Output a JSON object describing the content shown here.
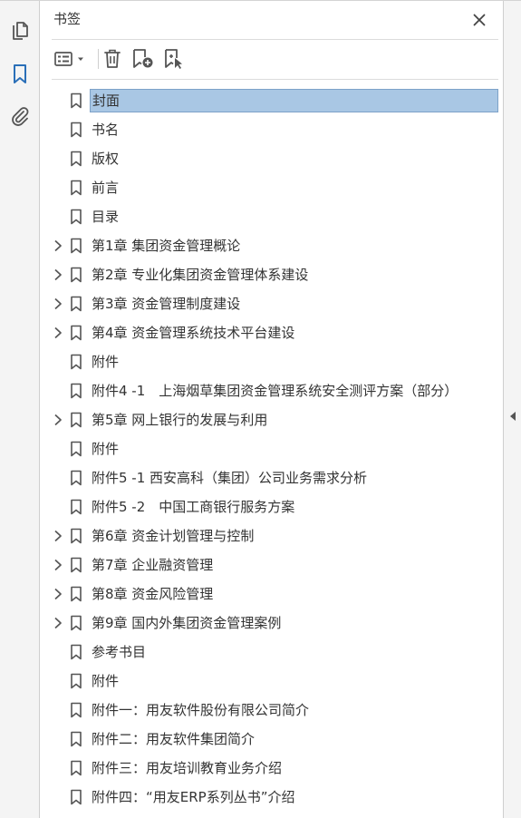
{
  "panel": {
    "title": "书签"
  },
  "rail": {
    "icons": [
      "page-thumbnails-icon",
      "bookmark-icon",
      "attachment-icon"
    ],
    "active_index": 1
  },
  "toolbar": {
    "icons": [
      "options-menu-icon",
      "delete-icon",
      "new-bookmark-icon",
      "bookmark-from-selection-icon"
    ]
  },
  "colors": {
    "accent": "#2a6fb8",
    "icon": "#555555",
    "selection_fill": "#a9c7e4",
    "selection_border": "#7da2c8"
  },
  "bookmarks": [
    {
      "label": "封面",
      "expandable": false,
      "selected": true
    },
    {
      "label": "书名",
      "expandable": false,
      "selected": false
    },
    {
      "label": "版权",
      "expandable": false,
      "selected": false
    },
    {
      "label": "前言",
      "expandable": false,
      "selected": false
    },
    {
      "label": "目录",
      "expandable": false,
      "selected": false
    },
    {
      "label": "第1章 集团资金管理概论",
      "expandable": true,
      "selected": false
    },
    {
      "label": "第2章 专业化集团资金管理体系建设",
      "expandable": true,
      "selected": false
    },
    {
      "label": "第3章 资金管理制度建设",
      "expandable": true,
      "selected": false
    },
    {
      "label": "第4章 资金管理系统技术平台建设",
      "expandable": true,
      "selected": false
    },
    {
      "label": "附件",
      "expandable": false,
      "selected": false
    },
    {
      "label": "附件4 -1　上海烟草集团资金管理系统安全测评方案（部分）",
      "expandable": false,
      "selected": false
    },
    {
      "label": "第5章 网上银行的发展与利用",
      "expandable": true,
      "selected": false
    },
    {
      "label": "附件",
      "expandable": false,
      "selected": false
    },
    {
      "label": "附件5 -1 西安高科（集团）公司业务需求分析",
      "expandable": false,
      "selected": false
    },
    {
      "label": "附件5 -2　中国工商银行服务方案",
      "expandable": false,
      "selected": false
    },
    {
      "label": "第6章 资金计划管理与控制",
      "expandable": true,
      "selected": false
    },
    {
      "label": "第7章 企业融资管理",
      "expandable": true,
      "selected": false
    },
    {
      "label": "第8章 资金风险管理",
      "expandable": true,
      "selected": false
    },
    {
      "label": "第9章 国内外集团资金管理案例",
      "expandable": true,
      "selected": false
    },
    {
      "label": "参考书目",
      "expandable": false,
      "selected": false
    },
    {
      "label": "附件",
      "expandable": false,
      "selected": false
    },
    {
      "label": "附件一：用友软件股份有限公司简介",
      "expandable": false,
      "selected": false
    },
    {
      "label": "附件二：用友软件集团简介",
      "expandable": false,
      "selected": false
    },
    {
      "label": "附件三：用友培训教育业务介绍",
      "expandable": false,
      "selected": false
    },
    {
      "label": "附件四：“用友ERP系列丛书”介绍",
      "expandable": false,
      "selected": false
    }
  ]
}
